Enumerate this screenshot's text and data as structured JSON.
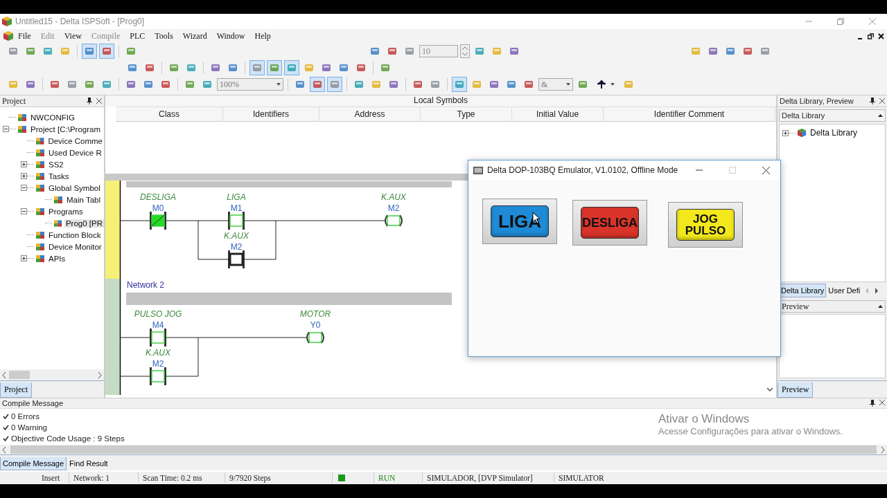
{
  "window": {
    "title": "Untitled15 - Delta ISPSoft - [Prog0]"
  },
  "menu": [
    {
      "label": "File",
      "disabled": false
    },
    {
      "label": "Edit",
      "disabled": true
    },
    {
      "label": "View",
      "disabled": false
    },
    {
      "label": "Compile",
      "disabled": true
    },
    {
      "label": "PLC",
      "disabled": false
    },
    {
      "label": "Tools",
      "disabled": false
    },
    {
      "label": "Wizard",
      "disabled": false
    },
    {
      "label": "Window",
      "disabled": false
    },
    {
      "label": "Help",
      "disabled": false
    }
  ],
  "toolbar_rows": [
    {
      "groups": [
        {
          "items": [
            {
              "kind": "button",
              "pressed": false
            },
            {
              "kind": "button",
              "pressed": false
            },
            {
              "kind": "button",
              "pressed": false
            },
            {
              "kind": "button",
              "pressed": false
            },
            {
              "kind": "separator"
            },
            {
              "kind": "button",
              "pressed": true
            },
            {
              "kind": "button",
              "pressed": true
            },
            {
              "kind": "separator"
            },
            {
              "kind": "button",
              "pressed": false
            }
          ]
        },
        {
          "items": [
            {
              "kind": "button",
              "pressed": false
            },
            {
              "kind": "button",
              "pressed": false
            },
            {
              "kind": "button",
              "pressed": false
            },
            {
              "kind": "spin",
              "value": "10"
            },
            {
              "kind": "button",
              "pressed": false
            },
            {
              "kind": "button",
              "pressed": false
            },
            {
              "kind": "button",
              "pressed": false
            }
          ]
        },
        {
          "items": [
            {
              "kind": "button",
              "pressed": false
            },
            {
              "kind": "button",
              "pressed": false
            },
            {
              "kind": "button",
              "pressed": false
            },
            {
              "kind": "button",
              "pressed": false
            },
            {
              "kind": "button",
              "pressed": false
            }
          ]
        }
      ]
    },
    {
      "groups": [
        {
          "items": [
            {
              "kind": "button",
              "pressed": false
            },
            {
              "kind": "button",
              "pressed": false
            },
            {
              "kind": "separator"
            },
            {
              "kind": "button",
              "pressed": false
            },
            {
              "kind": "button",
              "pressed": false
            },
            {
              "kind": "separator"
            },
            {
              "kind": "button",
              "pressed": false
            },
            {
              "kind": "button",
              "pressed": false
            },
            {
              "kind": "separator"
            },
            {
              "kind": "button",
              "pressed": true
            },
            {
              "kind": "button",
              "pressed": true
            },
            {
              "kind": "button",
              "pressed": true
            },
            {
              "kind": "button",
              "pressed": false
            },
            {
              "kind": "button",
              "pressed": false
            },
            {
              "kind": "button",
              "pressed": false
            },
            {
              "kind": "button",
              "pressed": false
            },
            {
              "kind": "separator"
            },
            {
              "kind": "button",
              "pressed": false
            }
          ]
        }
      ]
    },
    {
      "groups": [
        {
          "items": [
            {
              "kind": "button",
              "pressed": false
            },
            {
              "kind": "button",
              "pressed": false
            },
            {
              "kind": "separator"
            },
            {
              "kind": "button",
              "pressed": false
            },
            {
              "kind": "button",
              "pressed": false
            },
            {
              "kind": "button",
              "pressed": false
            },
            {
              "kind": "button",
              "pressed": false
            },
            {
              "kind": "separator"
            },
            {
              "kind": "button",
              "pressed": false
            },
            {
              "kind": "button",
              "pressed": false
            },
            {
              "kind": "button",
              "pressed": false
            },
            {
              "kind": "separator"
            },
            {
              "kind": "button",
              "pressed": false
            },
            {
              "kind": "button",
              "pressed": false
            },
            {
              "kind": "combo",
              "value": "100%"
            },
            {
              "kind": "separator"
            },
            {
              "kind": "button",
              "pressed": false
            },
            {
              "kind": "button",
              "pressed": true
            },
            {
              "kind": "button",
              "pressed": true
            },
            {
              "kind": "separator"
            },
            {
              "kind": "button",
              "pressed": false
            },
            {
              "kind": "button",
              "pressed": false
            },
            {
              "kind": "button",
              "pressed": false
            },
            {
              "kind": "separator"
            },
            {
              "kind": "button",
              "pressed": false
            },
            {
              "kind": "button",
              "pressed": false
            },
            {
              "kind": "separator"
            },
            {
              "kind": "button",
              "pressed": true
            },
            {
              "kind": "button",
              "pressed": false
            },
            {
              "kind": "button",
              "pressed": false
            },
            {
              "kind": "button",
              "pressed": false
            },
            {
              "kind": "button",
              "pressed": false
            },
            {
              "kind": "combo",
              "value": "&"
            },
            {
              "kind": "button",
              "pressed": false
            },
            {
              "kind": "dropdown_button",
              "pressed": false
            },
            {
              "kind": "button",
              "pressed": false
            }
          ]
        }
      ]
    }
  ],
  "project_panel": {
    "title": "Project",
    "tab": "Project",
    "tree": [
      {
        "label": "NWCONFIG",
        "selected": false
      },
      {
        "label": "Project [C:\\Program",
        "expanded": true,
        "selected": false,
        "children": [
          {
            "label": "Device Comme",
            "selected": false
          },
          {
            "label": "Used Device R",
            "selected": false
          },
          {
            "label": "SS2",
            "expanded": false,
            "selected": false
          },
          {
            "label": "Tasks",
            "expanded": false,
            "selected": false
          },
          {
            "label": "Global Symbol",
            "expanded": true,
            "selected": false,
            "children": [
              {
                "label": "Main Tabl",
                "selected": false
              }
            ]
          },
          {
            "label": "Programs",
            "expanded": true,
            "selected": false,
            "children": [
              {
                "label": "Prog0 [PR",
                "selected": true
              }
            ]
          },
          {
            "label": "Function Block",
            "selected": false
          },
          {
            "label": "Device Monitor",
            "selected": false
          },
          {
            "label": "APIs",
            "expanded": false,
            "selected": false
          }
        ]
      }
    ]
  },
  "local_symbols": {
    "title": "Local Symbols",
    "columns": [
      "Class",
      "Identifiers",
      "Address",
      "Type",
      "Initial Value",
      "Identifier Comment"
    ]
  },
  "ladder": {
    "networks": [
      {
        "elements": [
          {
            "kind": "nc_contact",
            "symbol": "DESLIGA",
            "address": "M0",
            "on": true,
            "selected": false
          },
          {
            "kind": "no_contact",
            "symbol": "LIGA",
            "address": "M1",
            "on": false,
            "selected": false
          },
          {
            "kind": "no_contact",
            "symbol": "K.AUX",
            "address": "M2",
            "on": false,
            "selected": true
          },
          {
            "kind": "coil",
            "symbol": "K.AUX",
            "address": "M2",
            "on": false,
            "selected": false
          }
        ]
      },
      {
        "label": "Network 2",
        "elements": [
          {
            "kind": "no_contact",
            "symbol": "PULSO JOG",
            "address": "M4",
            "on": false,
            "selected": false
          },
          {
            "kind": "no_contact",
            "symbol": "K.AUX",
            "address": "M2",
            "on": false,
            "selected": false
          },
          {
            "kind": "coil",
            "symbol": "MOTOR",
            "address": "Y0",
            "on": false,
            "selected": false
          }
        ]
      }
    ]
  },
  "emulator": {
    "title": "Delta DOP-103BQ Emulator, V1.0102, Offline Mode",
    "buttons": [
      {
        "lines": [
          "LIGA"
        ],
        "color": "#1f8ad6"
      },
      {
        "lines": [
          "DESLIGA"
        ],
        "color": "#d8342a"
      },
      {
        "lines": [
          "JOG",
          "PULSO"
        ],
        "color": "#f2e81c"
      }
    ]
  },
  "library_panel": {
    "title": "Delta Library, Preview",
    "dropdown": "Delta Library",
    "tree": [
      {
        "label": "Delta Library",
        "expanded": false
      }
    ],
    "tabs": [
      {
        "label": "Delta Library",
        "selected": true
      },
      {
        "label": "User Defi",
        "selected": false
      }
    ],
    "preview_title": "Preview",
    "preview_tab": "Preview"
  },
  "compile_panel": {
    "title": "Compile Message",
    "messages": [
      "0 Errors",
      "0 Warning",
      "Objective Code Usage : 9 Steps"
    ],
    "tabs": [
      {
        "label": "Compile Message",
        "selected": true
      },
      {
        "label": "Find Result",
        "selected": false
      }
    ]
  },
  "activation_notice": {
    "title": "Ativar o Windows",
    "text": "Acesse Configurações para ativar o Windows."
  },
  "status_bar": {
    "mode": "Insert",
    "network": "Network: 1",
    "scan_time": "Scan Time: 0.2 ms",
    "steps": "9/7920 Steps",
    "running": true,
    "state": "RUN",
    "connection": "SIMULADOR, [DVP Simulator]",
    "device": "SIMULATOR"
  }
}
